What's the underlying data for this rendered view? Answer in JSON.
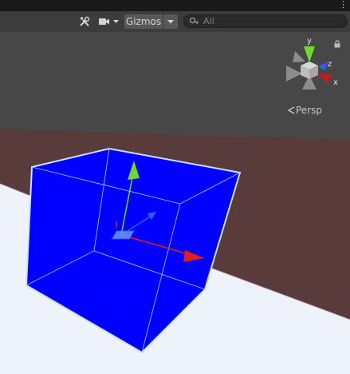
{
  "toolbar": {
    "tools_icon": "wrench-screwdriver-icon",
    "camera_icon": "video-camera-icon",
    "camera_dropdown_icon": "chevron-down-icon",
    "gizmos_label": "Gizmos",
    "gizmos_dropdown_icon": "chevron-down-icon",
    "search": {
      "icon": "search-icon",
      "placeholder": "All",
      "value": ""
    },
    "more_icon": "kebab-menu-icon"
  },
  "scene_view": {
    "projection_label": "Persp",
    "orientation_gizmo": {
      "axes": [
        "y",
        "z",
        "x"
      ],
      "lock_icon": "lock-icon"
    },
    "colors": {
      "sky": "#474747",
      "ground_plane": "#5a3b3b",
      "floor": "#eef2fb",
      "cube": "#0000ff",
      "selection_outline": "#c9e0ff",
      "x_axis": "#e0201b",
      "y_axis": "#6fd92b",
      "z_axis": "#2f5fe6"
    }
  }
}
